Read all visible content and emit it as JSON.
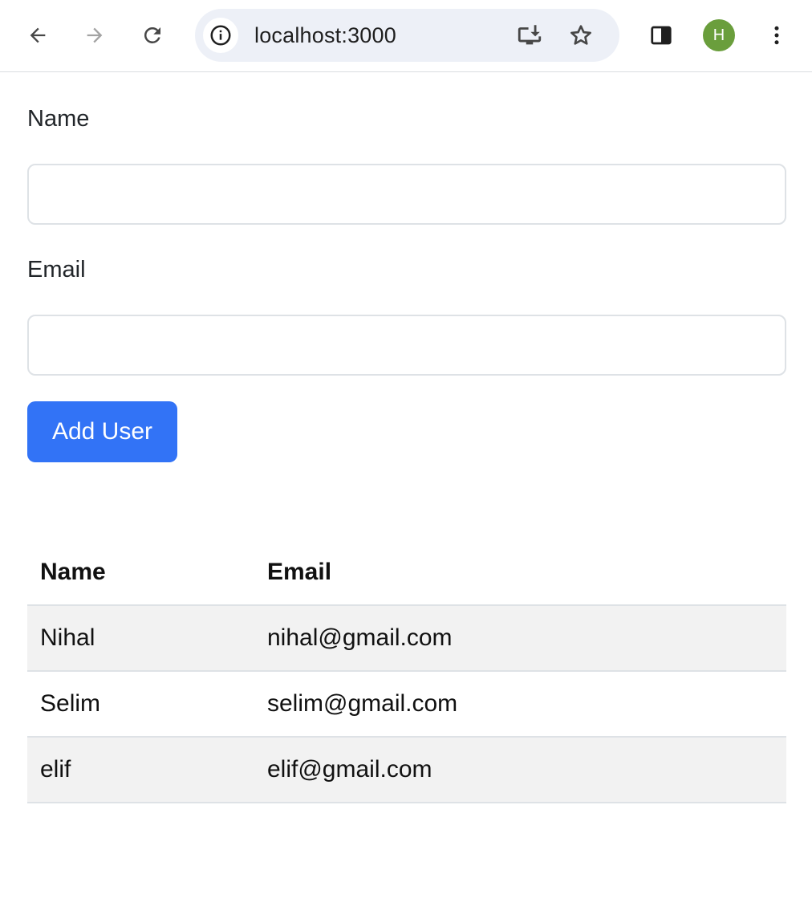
{
  "browser": {
    "url": "localhost:3000",
    "profile_initial": "H",
    "profile_color": "#6a9e3c",
    "icons": [
      "back-icon",
      "forward-icon",
      "reload-icon",
      "site-info-icon",
      "install-app-icon",
      "bookmark-star-icon",
      "side-panel-icon",
      "kebab-menu-icon"
    ]
  },
  "form": {
    "name_label": "Name",
    "name_value": "",
    "email_label": "Email",
    "email_value": "",
    "submit_label": "Add User",
    "accent_color": "#3273f6"
  },
  "table": {
    "headers": [
      "Name",
      "Email"
    ],
    "rows": [
      {
        "name": "Nihal",
        "email": "nihal@gmail.com"
      },
      {
        "name": "Selim",
        "email": "selim@gmail.com"
      },
      {
        "name": "elif",
        "email": "elif@gmail.com"
      }
    ]
  }
}
